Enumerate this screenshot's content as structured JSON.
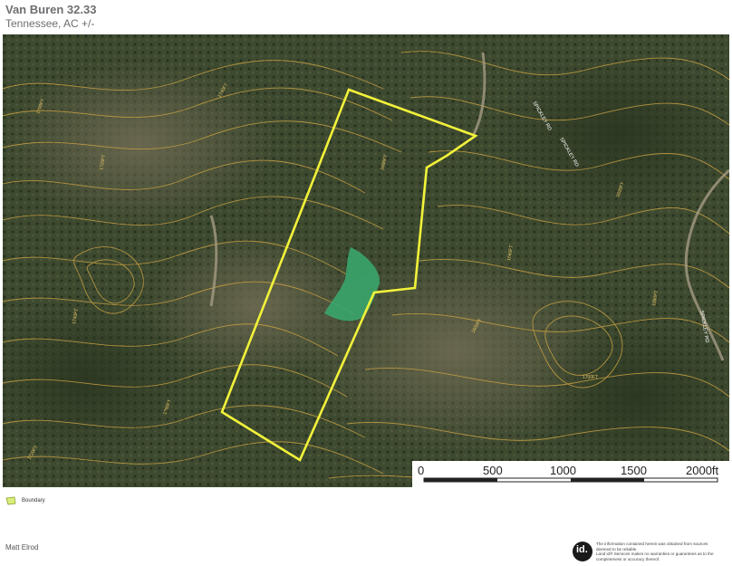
{
  "header": {
    "title": "Van Buren 32.33",
    "subtitle": "Tennessee,  AC +/-"
  },
  "map": {
    "contour_labels": [
      "1700FT",
      "1720FT",
      "1740FT",
      "1680FT",
      "1660FT",
      "1620FT",
      "1600FT",
      "1780FT"
    ],
    "road_labels": [
      "SPICKLEY RD",
      "SPICKLEY RD",
      "SPICKLEY RD"
    ],
    "colors": {
      "boundary": "#f2f23a",
      "contour": "#c8a043",
      "pond": "#3aa56b",
      "forest": "#3d4a2e"
    }
  },
  "scalebar": {
    "labels": [
      "0",
      "500",
      "1000",
      "1500",
      "2000ft"
    ]
  },
  "legend": {
    "boundary_label": "Boundary",
    "swatch_color": "#d8ee7a"
  },
  "footer": {
    "agent_name": "Matt Elrod",
    "logo_text": "id.",
    "disclaimer_lines": [
      "The information contained herein was obtained from sources",
      "deemed to be reliable.",
      "Land id® Services makes no warranties or guarantees as to the",
      "completeness or accuracy thereof."
    ]
  }
}
